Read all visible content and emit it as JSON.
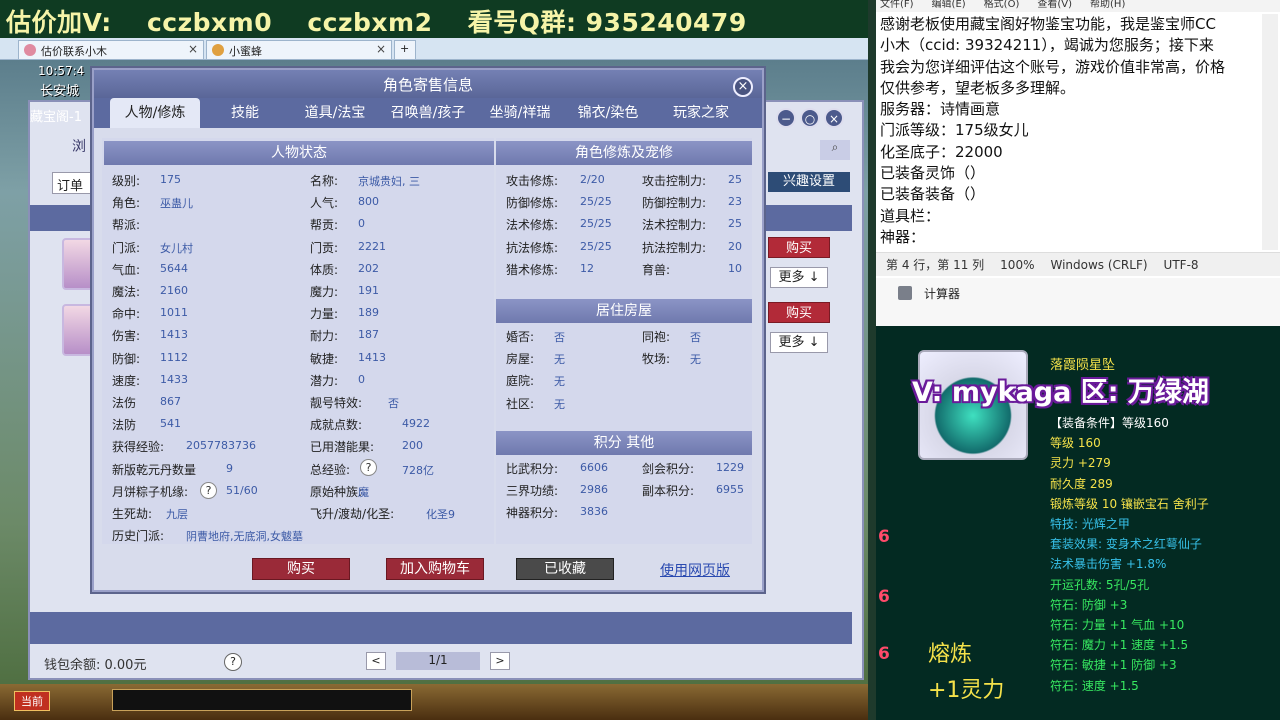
{
  "banner": {
    "text1": "估价加V:",
    "text2": "cczbxm0",
    "text3": "cczbxm2",
    "text4": "看号Q群: 935240479"
  },
  "browser_tabs": [
    {
      "label": "估价联系小木"
    },
    {
      "label": "小蜜蜂"
    }
  ],
  "game": {
    "time": "10:57:4",
    "city": "长安城"
  },
  "shop": {
    "title": "藏宝阁-1",
    "nav_label": "浏",
    "search_icon": "search-icon",
    "sort_label": "订单",
    "fun_settings": "兴趣设置",
    "buy_label": "购买",
    "more_label": "更多 ↓",
    "wallet": "钱包余额: 0.00元",
    "page": "1/1",
    "prev": "<",
    "next": ">"
  },
  "taskbar": {
    "now_label": "当前"
  },
  "dialog": {
    "title": "角色寄售信息",
    "close": "×",
    "tabs": [
      "人物/修炼",
      "技能",
      "道具/法宝",
      "召唤兽/孩子",
      "坐骑/祥瑞",
      "锦衣/染色",
      "玩家之家"
    ],
    "status_title": "人物状态",
    "cultivation_title": "角色修炼及宠修",
    "housing_title": "居住房屋",
    "points_title": "积分 其他",
    "status_left": [
      {
        "label": "级别:",
        "value": "175"
      },
      {
        "label": "角色:",
        "value": "巫蛊儿"
      },
      {
        "label": "帮派:",
        "value": ""
      },
      {
        "label": "门派:",
        "value": "女儿村"
      },
      {
        "label": "气血:",
        "value": "5644"
      },
      {
        "label": "魔法:",
        "value": "2160"
      },
      {
        "label": "命中:",
        "value": "1011"
      },
      {
        "label": "伤害:",
        "value": "1413"
      },
      {
        "label": "防御:",
        "value": "1112"
      },
      {
        "label": "速度:",
        "value": "1433"
      },
      {
        "label": "法伤",
        "value": "867"
      },
      {
        "label": "法防",
        "value": "541"
      },
      {
        "label": "获得经验:",
        "value": "2057783736"
      },
      {
        "label": "新版乾元丹数量",
        "value": "9"
      },
      {
        "label": "月饼粽子机缘:",
        "value": "51/60"
      },
      {
        "label": "生死劫:",
        "value": "九层"
      },
      {
        "label": "历史门派:",
        "value": "阴曹地府,无底洞,女魃墓"
      }
    ],
    "status_right": [
      {
        "label": "名称:",
        "value": "京城贵妇, 三"
      },
      {
        "label": "人气:",
        "value": "800"
      },
      {
        "label": "帮贡:",
        "value": "0"
      },
      {
        "label": "门贡:",
        "value": "2221"
      },
      {
        "label": "体质:",
        "value": "202"
      },
      {
        "label": "魔力:",
        "value": "191"
      },
      {
        "label": "力量:",
        "value": "189"
      },
      {
        "label": "耐力:",
        "value": "187"
      },
      {
        "label": "敏捷:",
        "value": "1413"
      },
      {
        "label": "潜力:",
        "value": "0"
      },
      {
        "label": "靓号特效:",
        "value": "否"
      },
      {
        "label": "成就点数:",
        "value": "4922"
      },
      {
        "label": "已用潜能果:",
        "value": "200"
      },
      {
        "label": "总经验:",
        "value": "728亿"
      },
      {
        "label": "原始种族:",
        "value": "魔"
      },
      {
        "label": "飞升/渡劫/化圣:",
        "value": "化圣9"
      }
    ],
    "cultivation": [
      {
        "l1": "攻击修炼:",
        "v1": "2/20",
        "l2": "攻击控制力:",
        "v2": "25"
      },
      {
        "l1": "防御修炼:",
        "v1": "25/25",
        "l2": "防御控制力:",
        "v2": "23"
      },
      {
        "l1": "法术修炼:",
        "v1": "25/25",
        "l2": "法术控制力:",
        "v2": "25"
      },
      {
        "l1": "抗法修炼:",
        "v1": "25/25",
        "l2": "抗法控制力:",
        "v2": "20"
      },
      {
        "l1": "猎术修炼:",
        "v1": "12",
        "l2": "育兽:",
        "v2": "10"
      }
    ],
    "housing": [
      {
        "l1": "婚否:",
        "v1": "否",
        "l2": "同袍:",
        "v2": "否"
      },
      {
        "l1": "房屋:",
        "v1": "无",
        "l2": "牧场:",
        "v2": "无"
      },
      {
        "l1": "庭院:",
        "v1": "无",
        "l2": "",
        "v2": ""
      },
      {
        "l1": "社区:",
        "v1": "无",
        "l2": "",
        "v2": ""
      }
    ],
    "points": [
      {
        "l1": "比武积分:",
        "v1": "6606",
        "l2": "剑会积分:",
        "v2": "1229"
      },
      {
        "l1": "三界功绩:",
        "v1": "2986",
        "l2": "副本积分:",
        "v2": "6955"
      },
      {
        "l1": "神器积分:",
        "v1": "3836",
        "l2": "",
        "v2": ""
      }
    ],
    "buttons": {
      "buy": "购买",
      "cart": "加入购物车",
      "favorited": "已收藏",
      "web": "使用网页版"
    }
  },
  "notepad": {
    "menu": [
      "文件(F)",
      "编辑(E)",
      "格式(O)",
      "查看(V)",
      "帮助(H)"
    ],
    "lines": [
      "感谢老板使用藏宝阁好物鉴宝功能，我是鉴宝师CC",
      "小木（ccid: 39324211），竭诚为您服务；接下来",
      "我会为您详细评估这个账号，游戏价值非常高，价格",
      "仅供参考，望老板多多理解。",
      "服务器：诗情画意",
      "门派等级：175级女儿",
      "化圣底子：22000",
      "已装备灵饰（）",
      "已装备装备（）",
      "道具栏：",
      "神器："
    ],
    "status": [
      "第 4 行，第 11 列",
      "100%",
      "Windows (CRLF)",
      "UTF-8"
    ]
  },
  "calculator": {
    "label": "计算器"
  },
  "item": {
    "name": "落霞陨星坠",
    "overlay": "V: mykaga  区: 万绿湖",
    "lines": [
      {
        "text": "【装备条件】等级160",
        "color": "#ffffff"
      },
      {
        "text": "等级 160",
        "color": "#f5e24a"
      },
      {
        "text": "灵力 +279",
        "color": "#f5e24a"
      },
      {
        "text": "耐久度 289",
        "color": "#f5e24a"
      },
      {
        "text": "锻炼等级 10  镶嵌宝石 舍利子",
        "color": "#f5e24a"
      },
      {
        "text": "特技: 光辉之甲",
        "color": "#37c0e8"
      },
      {
        "text": "套装效果: 变身术之红萼仙子",
        "color": "#37c0e8"
      },
      {
        "text": "法术暴击伤害 +1.8%",
        "color": "#37c0e8"
      },
      {
        "text": "开运孔数: 5孔/5孔",
        "color": "#37e860"
      },
      {
        "text": "符石: 防御 +3",
        "color": "#37e860"
      },
      {
        "text": "符石: 力量 +1  气血 +10",
        "color": "#37e860"
      },
      {
        "text": "符石: 魔力 +1  速度 +1.5",
        "color": "#37e860"
      },
      {
        "text": "符石: 敏捷 +1  防御 +3",
        "color": "#37e860"
      },
      {
        "text": "符石: 速度 +1.5",
        "color": "#37e860"
      }
    ],
    "side_marks": [
      "6",
      "6",
      "6"
    ],
    "smelt1": "熔炼",
    "smelt2": "+1灵力"
  }
}
